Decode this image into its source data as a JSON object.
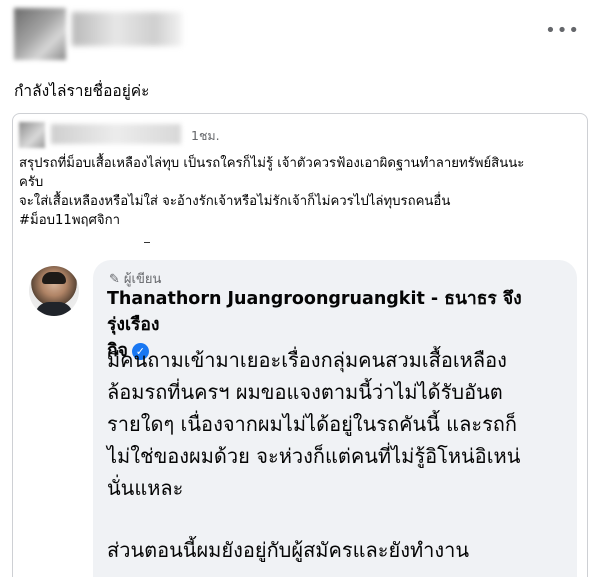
{
  "post": {
    "more_icon": "more-horizontal-icon",
    "text": "กำลังไล่รายชื่ออยู่ค่ะ"
  },
  "shared": {
    "time": "1ชม.",
    "lines": [
      "สรุปรถที่ม็อบเสื้อเหลืองไล่ทุบ เป็นรถใครก็ไม่รู้ เจ้าตัวควรฟ้องเอาผิดฐานทำลายทรัพย์สินนะ",
      "ครับ",
      "จะใส่เสื้อเหลืองหรือไม่ใส่ จะอ้างรักเจ้าหรือไม่รักเจ้าก็ไม่ควรไปไล่ทุบรถคนอื่น"
    ],
    "hashtag": "#ม็อบ11พฤศจิกา"
  },
  "embed": {
    "author_tag": "ผู้เขียน",
    "author_name_line1": "Thanathorn Juangroongruangkit - ธนาธร จึงรุ่งเรือง",
    "author_name_line2": "กิจ",
    "verified_icon": "verified-check-icon",
    "body_lines": [
      "มีคนถามเข้ามาเยอะเรื่องกลุ่มคนสวมเสื้อเหลือง",
      "ล้อมรถที่นครฯ ผมขอแจงตามนี้ว่าไม่ได้รับอันต",
      "รายใดๆ เนื่องจากผมไม่ได้อยู่ในรถคันนี้ และรถก็",
      "ไม่ใช่ของผมด้วย จะห่วงก็แต่คนที่ไม่รู้อิโหน่อิเหน่",
      "นั่นแหละ"
    ],
    "body_last": "ส่วนตอนนี้ผมยังอยู่กับผู้สมัครและยังทำงาน"
  }
}
